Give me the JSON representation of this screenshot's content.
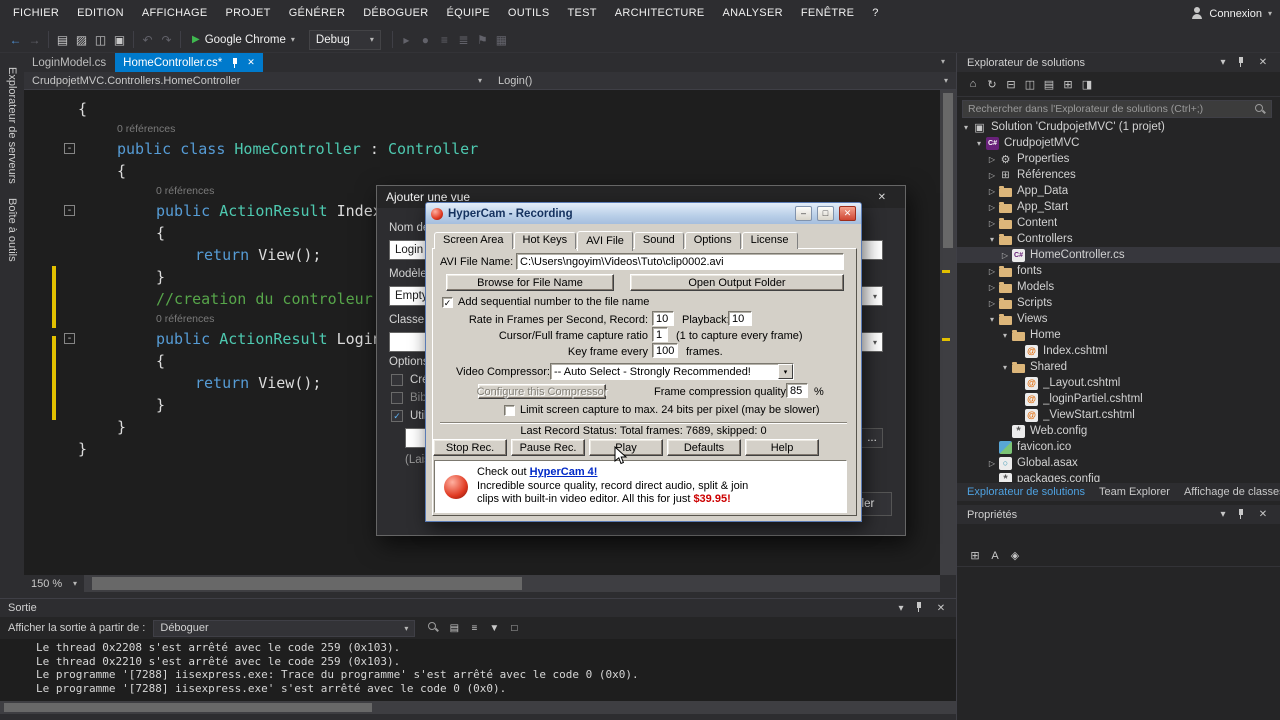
{
  "glyphs": {
    "chevron_down": "▾",
    "close": "✕",
    "play": "▶",
    "tree_expanded": "▾",
    "tree_collapsed": "▷",
    "check": "✓",
    "fold": "-"
  },
  "menubar": {
    "items": [
      "FICHIER",
      "EDITION",
      "AFFICHAGE",
      "PROJET",
      "GÉNÉRER",
      "DÉBOGUER",
      "ÉQUIPE",
      "OUTILS",
      "TEST",
      "ARCHITECTURE",
      "ANALYSER",
      "FENÊTRE",
      "?"
    ],
    "connexion_label": "Connexion"
  },
  "toolbar": {
    "left_icons": [
      {
        "name": "navigate-back-icon",
        "glyph": "←",
        "accent": true
      },
      {
        "name": "navigate-forward-icon",
        "glyph": "→",
        "dim": true
      },
      {
        "name": "new-file-icon",
        "glyph": "▤"
      },
      {
        "name": "open-file-icon",
        "glyph": "▨"
      },
      {
        "name": "save-icon",
        "glyph": "◫"
      },
      {
        "name": "save-all-icon",
        "glyph": "▣"
      },
      {
        "name": "undo-icon",
        "glyph": "↶",
        "dim": true
      },
      {
        "name": "redo-icon",
        "glyph": "↷",
        "dim": true
      }
    ],
    "run_label": "Google Chrome",
    "debug_label": "Debug",
    "right_icons": [
      {
        "name": "attach-process-icon",
        "glyph": "▸",
        "dim": true
      },
      {
        "name": "breakpoint-icon",
        "glyph": "●",
        "dim": true
      },
      {
        "name": "comment-icon",
        "glyph": "≡",
        "dim": true
      },
      {
        "name": "uncomment-icon",
        "glyph": "≣",
        "dim": true
      },
      {
        "name": "bookmark-icon",
        "glyph": "⚑",
        "dim": true
      },
      {
        "name": "indent-icon",
        "glyph": "▦",
        "dim": true
      }
    ]
  },
  "editor_tabs": [
    {
      "label": "LoginModel.cs",
      "active": false
    },
    {
      "label": "HomeController.cs*",
      "active": true
    }
  ],
  "navbar": {
    "context": "CrudpojetMVC.Controllers.HomeController",
    "member": "Login()"
  },
  "left_strip": [
    "Explorateur de serveurs",
    "Boîte à outils"
  ],
  "editor": {
    "zoom_value": "150 %",
    "code_lines": [
      {
        "i": 0,
        "segs": [
          [
            "{",
            "p"
          ]
        ]
      },
      {
        "i": 1,
        "lens": true,
        "segs": [
          [
            "0 références",
            "l"
          ]
        ]
      },
      {
        "i": 1,
        "fold": true,
        "segs": [
          [
            "public class ",
            "k"
          ],
          [
            "HomeController",
            "t"
          ],
          [
            " : ",
            "p"
          ],
          [
            "Controller",
            "t"
          ]
        ]
      },
      {
        "i": 1,
        "segs": [
          [
            "{",
            "p"
          ]
        ]
      },
      {
        "i": 2,
        "lens": true,
        "segs": [
          [
            "0 références",
            "l"
          ]
        ]
      },
      {
        "i": 2,
        "fold": true,
        "segs": [
          [
            "public ",
            "k"
          ],
          [
            "ActionResult",
            "t"
          ],
          [
            " Index()",
            "p"
          ]
        ]
      },
      {
        "i": 2,
        "segs": [
          [
            "{",
            "p"
          ]
        ]
      },
      {
        "i": 3,
        "segs": [
          [
            "return",
            "k"
          ],
          [
            " View();",
            "p"
          ]
        ]
      },
      {
        "i": 2,
        "segs": [
          [
            "}",
            "p"
          ]
        ]
      },
      {
        "i": 2,
        "segs": [
          [
            "//creation du controleur login",
            "c"
          ]
        ]
      },
      {
        "i": 2,
        "lens": true,
        "segs": [
          [
            "0 références",
            "l"
          ]
        ]
      },
      {
        "i": 2,
        "fold": true,
        "segs": [
          [
            "public ",
            "k"
          ],
          [
            "ActionResult",
            "t"
          ],
          [
            " Login()",
            "p"
          ]
        ]
      },
      {
        "i": 2,
        "segs": [
          [
            "{",
            "p"
          ]
        ]
      },
      {
        "i": 3,
        "segs": [
          [
            "return",
            "k"
          ],
          [
            " View();",
            "p"
          ]
        ]
      },
      {
        "i": 2,
        "segs": [
          [
            "}",
            "p"
          ]
        ]
      },
      {
        "i": 1,
        "segs": [
          [
            "}",
            "p"
          ]
        ]
      },
      {
        "i": 0,
        "segs": [
          [
            "}",
            "p"
          ]
        ]
      }
    ]
  },
  "solution_explorer": {
    "title": "Explorateur de solutions",
    "search_placeholder": "Rechercher dans l'Explorateur de solutions (Ctrl+;)",
    "toolbar_icons": [
      {
        "name": "home-icon",
        "glyph": "⌂"
      },
      {
        "name": "sync-with-active-document-icon",
        "glyph": "↻"
      },
      {
        "name": "collapse-all-icon",
        "glyph": "⊟"
      },
      {
        "name": "properties-window-icon",
        "glyph": "◫"
      },
      {
        "name": "show-all-files-icon",
        "glyph": "▤"
      },
      {
        "name": "refresh-icon",
        "glyph": "⊞"
      },
      {
        "name": "preview-icon",
        "glyph": "◨"
      }
    ],
    "tree": [
      {
        "label": "Solution 'CrudpojetMVC' (1 projet)",
        "indent": 0,
        "arrow": "expanded",
        "icon": "solution-icon",
        "g": "▣"
      },
      {
        "label": "CrudpojetMVC",
        "indent": 1,
        "arrow": "expanded",
        "icon": "project-icon",
        "g": "C#"
      },
      {
        "label": "Properties",
        "indent": 2,
        "arrow": "collapsed",
        "icon": "properties-icon",
        "g": "⚙"
      },
      {
        "label": "Références",
        "indent": 2,
        "arrow": "collapsed",
        "icon": "references-icon",
        "g": "⊞"
      },
      {
        "label": "App_Data",
        "indent": 2,
        "arrow": "collapsed",
        "icon": "folder-icon",
        "g": ""
      },
      {
        "label": "App_Start",
        "indent": 2,
        "arrow": "collapsed",
        "icon": "folder-icon",
        "g": ""
      },
      {
        "label": "Content",
        "indent": 2,
        "arrow": "collapsed",
        "icon": "folder-icon",
        "g": ""
      },
      {
        "label": "Controllers",
        "indent": 2,
        "arrow": "expanded",
        "icon": "folder-icon",
        "g": ""
      },
      {
        "label": "HomeController.cs",
        "indent": 3,
        "arrow": "collapsed",
        "icon": "csharp-file-icon",
        "g": "C#",
        "selected": true
      },
      {
        "label": "fonts",
        "indent": 2,
        "arrow": "collapsed",
        "icon": "folder-icon",
        "g": ""
      },
      {
        "label": "Models",
        "indent": 2,
        "arrow": "collapsed",
        "icon": "folder-icon",
        "g": ""
      },
      {
        "label": "Scripts",
        "indent": 2,
        "arrow": "collapsed",
        "icon": "folder-icon",
        "g": ""
      },
      {
        "label": "Views",
        "indent": 2,
        "arrow": "expanded",
        "icon": "folder-icon",
        "g": ""
      },
      {
        "label": "Home",
        "indent": 3,
        "arrow": "expanded",
        "icon": "folder-icon",
        "g": ""
      },
      {
        "label": "Index.cshtml",
        "indent": 4,
        "arrow": "none",
        "icon": "cshtml-file-icon",
        "g": "@"
      },
      {
        "label": "Shared",
        "indent": 3,
        "arrow": "expanded",
        "icon": "folder-icon",
        "g": ""
      },
      {
        "label": "_Layout.cshtml",
        "indent": 4,
        "arrow": "none",
        "icon": "cshtml-file-icon",
        "g": "@"
      },
      {
        "label": "_loginPartiel.cshtml",
        "indent": 4,
        "arrow": "none",
        "icon": "cshtml-file-icon",
        "g": "@"
      },
      {
        "label": "_ViewStart.cshtml",
        "indent": 4,
        "arrow": "none",
        "icon": "cshtml-file-icon",
        "g": "@"
      },
      {
        "label": "Web.config",
        "indent": 3,
        "arrow": "none",
        "icon": "config-file-icon",
        "g": "*"
      },
      {
        "label": "favicon.ico",
        "indent": 2,
        "arrow": "none",
        "icon": "ico-file-icon",
        "g": ""
      },
      {
        "label": "Global.asax",
        "indent": 2,
        "arrow": "collapsed",
        "icon": "asax-file-icon",
        "g": "○"
      },
      {
        "label": "packages.config",
        "indent": 2,
        "arrow": "none",
        "icon": "config-file-icon",
        "g": "*"
      }
    ],
    "bottom_tabs": [
      {
        "label": "Explorateur de solutions",
        "active": true
      },
      {
        "label": "Team Explorer",
        "active": false
      },
      {
        "label": "Affichage de classes",
        "active": false
      }
    ]
  },
  "properties_panel": {
    "title": "Propriétés",
    "toolbar_icons": [
      {
        "name": "categorized-icon",
        "glyph": "⊞"
      },
      {
        "name": "alphabetical-icon",
        "glyph": "A"
      },
      {
        "name": "property-pages-icon",
        "glyph": "◈"
      }
    ]
  },
  "panel_icons": [
    {
      "name": "window-position-icon",
      "glyph": "▾"
    },
    {
      "name": "pin-icon",
      "shape": "pin"
    },
    {
      "name": "close-icon",
      "glyph": "✕"
    }
  ],
  "output_panel": {
    "title": "Sortie",
    "source_label": "Afficher la sortie à partir de :",
    "source_value": "Déboguer",
    "toolbar_icons": [
      {
        "name": "find-icon",
        "shape": "mag"
      },
      {
        "name": "clear-all-icon",
        "glyph": "▤"
      },
      {
        "name": "word-wrap-icon",
        "glyph": "≡"
      },
      {
        "name": "goto-message-icon",
        "glyph": "▼"
      },
      {
        "name": "stop-icon",
        "glyph": "□"
      }
    ],
    "lines": [
      "Le thread 0x2208 s'est arrêté avec le code 259 (0x103).",
      "Le thread 0x2210 s'est arrêté avec le code 259 (0x103).",
      "Le programme '[7288] iisexpress.exe: Trace du programme' s'est arrêté avec le code 0 (0x0).",
      "Le programme '[7288] iisexpress.exe' s'est arrêté avec le code 0 (0x0)."
    ]
  },
  "addview_dialog": {
    "title": "Ajouter une vue",
    "name_label": "Nom de la vue :",
    "name_value": "Login",
    "template_label": "Modèle :",
    "template_value": "Empty (sans modèle)",
    "model_label": "Classe de modèle :",
    "model_value": "",
    "options_label": "Options :",
    "cb_partial": "Créer en tant que vue partielle",
    "cb_scripts": "Bibliothèques de scripts de référence",
    "cb_layout": "Utiliser une page de disposition :",
    "layout_value": "",
    "layout_hint": "(Laissez vide si elle est définie dans un fichier _viewstart Razor)",
    "browse_label": "...",
    "cancel_label": "Annuler"
  },
  "hypercam": {
    "title": "HyperCam - Recording",
    "title_buttons": [
      {
        "name": "minimize-icon",
        "glyph": "–"
      },
      {
        "name": "maximize-icon",
        "glyph": "□"
      },
      {
        "name": "close-icon",
        "glyph": "✕"
      }
    ],
    "tabs": [
      "Screen Area",
      "Hot Keys",
      "AVI File",
      "Sound",
      "Options",
      "License"
    ],
    "active_tab": "AVI File",
    "file_label": "AVI File Name:",
    "file_value": "C:\\Users\\ngoyim\\Videos\\Tuto\\clip0002.avi",
    "browse_button": "Browse for File Name",
    "open_folder_button": "Open Output Folder",
    "seq_checkbox": "Add sequential number to the file name",
    "rate_label": "Rate in Frames per Second,  Record:",
    "rate_value": "10",
    "playback_label": "Playback:",
    "playback_value": "10",
    "cursor_label": "Cursor/Full frame capture ratio",
    "cursor_value": "1",
    "cursor_hint": "(1 to capture every frame)",
    "keyframe_label": "Key frame every",
    "keyframe_value": "100",
    "keyframe_hint": "frames.",
    "compressor_label": "Video Compressor:",
    "compressor_value": "-- Auto Select - Strongly Recommended!",
    "configure_button": "Configure this Compressor",
    "quality_label": "Frame compression quality",
    "quality_value": "85",
    "quality_unit": "%",
    "limit_checkbox": "Limit screen capture to max. 24 bits per pixel (may be slower)",
    "status_text": "Last Record Status: Total frames: 7689, skipped: 0",
    "buttons": [
      "Stop Rec.",
      "Pause Rec.",
      "Play",
      "Defaults",
      "Help"
    ],
    "ad": {
      "line1_prefix": "Check out ",
      "link": "HyperCam 4!",
      "line2": "Incredible source quality, record direct audio, split & join",
      "line3_prefix": "clips with built-in video editor. All this for just ",
      "price": "$39.95!"
    }
  }
}
